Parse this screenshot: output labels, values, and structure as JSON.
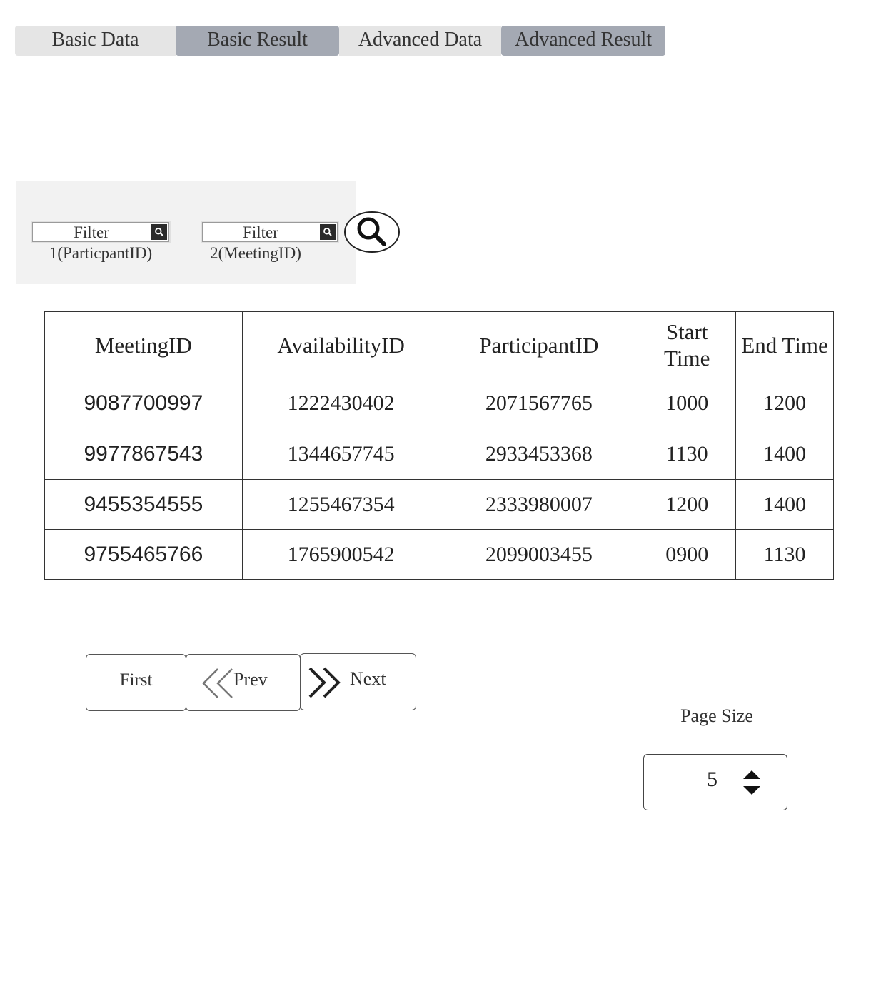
{
  "tabs": [
    {
      "label": "Basic Data"
    },
    {
      "label": "Basic Result"
    },
    {
      "label": "Advanced Data"
    },
    {
      "label": "Advanced Result"
    }
  ],
  "filters": {
    "filter1": {
      "placeholder": "Filter",
      "label": "1(ParticpantID)"
    },
    "filter2": {
      "placeholder": "Filter",
      "label": "2(MeetingID)"
    }
  },
  "table": {
    "headers": {
      "meeting_id": "MeetingID",
      "availability_id": "AvailabilityID",
      "participant_id": "ParticipantID",
      "start_time_1": "Start",
      "start_time_2": "Time",
      "end_time": "End Time"
    },
    "rows": [
      {
        "meeting_id": "9087700997",
        "availability_id": "1222430402",
        "participant_id": "2071567765",
        "start": "1000",
        "end": "1200"
      },
      {
        "meeting_id": "9977867543",
        "availability_id": "1344657745",
        "participant_id": "2933453368",
        "start": "1130",
        "end": "1400"
      },
      {
        "meeting_id": "9455354555",
        "availability_id": "1255467354",
        "participant_id": "2333980007",
        "start": "1200",
        "end": "1400"
      },
      {
        "meeting_id": "9755465766",
        "availability_id": "1765900542",
        "participant_id": "2099003455",
        "start": "0900",
        "end": "1130"
      }
    ]
  },
  "pager": {
    "first_label": "First",
    "prev_label": "Prev",
    "next_label": "Next"
  },
  "page_size": {
    "label": "Page Size",
    "value": "5"
  },
  "icons": {
    "filter_button": "search-icon",
    "search_button": "magnifier-icon",
    "prev": "double-chevron-left-icon",
    "next": "double-chevron-right-icon",
    "spinner": "up-down-arrows-icon"
  },
  "colors": {
    "tab_light": "#e5e5e5",
    "tab_dark": "#a4a9b3",
    "panel": "#f2f2f2"
  }
}
